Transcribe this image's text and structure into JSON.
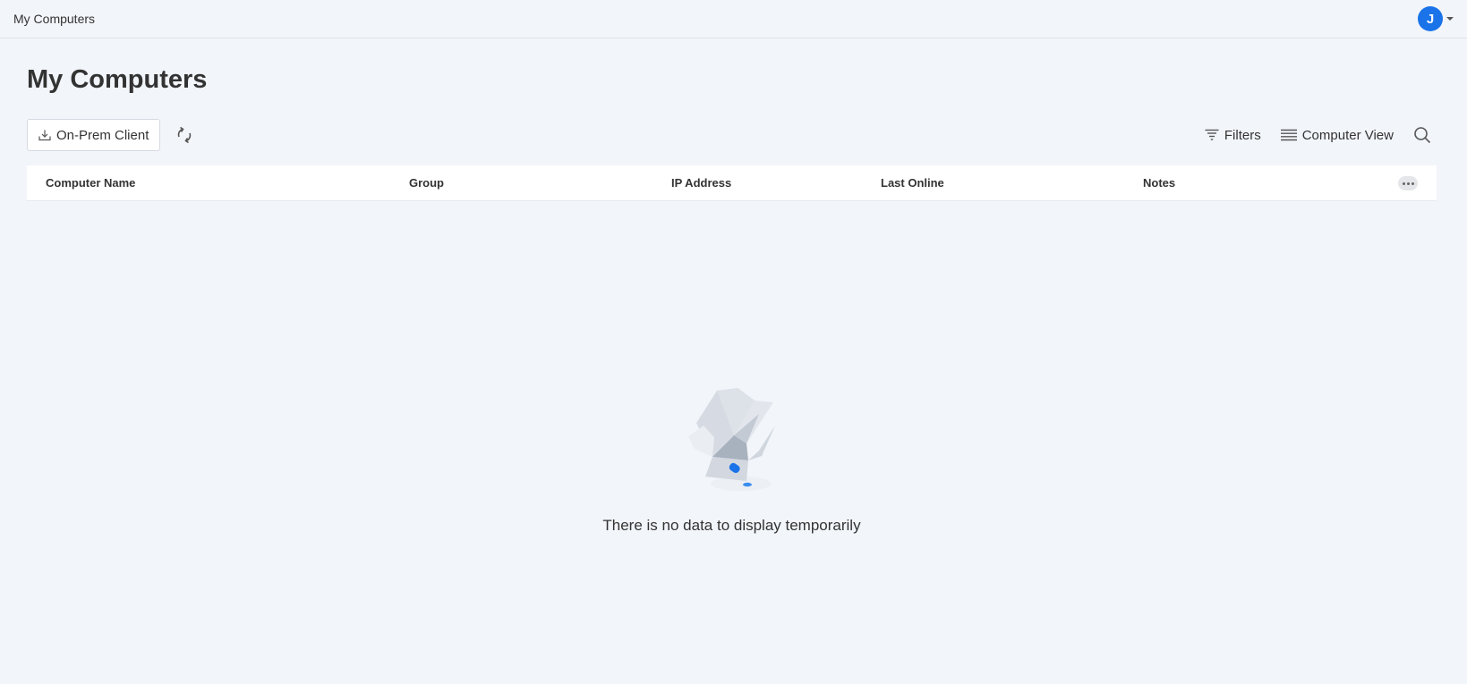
{
  "header": {
    "title": "My Computers",
    "user_initial": "J",
    "avatar_color": "#1a73e8"
  },
  "page": {
    "title": "My Computers"
  },
  "toolbar": {
    "onprem_label": "On-Prem Client",
    "filters_label": "Filters",
    "view_label": "Computer View"
  },
  "table": {
    "columns": [
      "Computer Name",
      "Group",
      "IP Address",
      "Last Online",
      "Notes"
    ]
  },
  "empty_state": {
    "message": "There is no data to display temporarily",
    "icon": "empty-box-icon"
  }
}
